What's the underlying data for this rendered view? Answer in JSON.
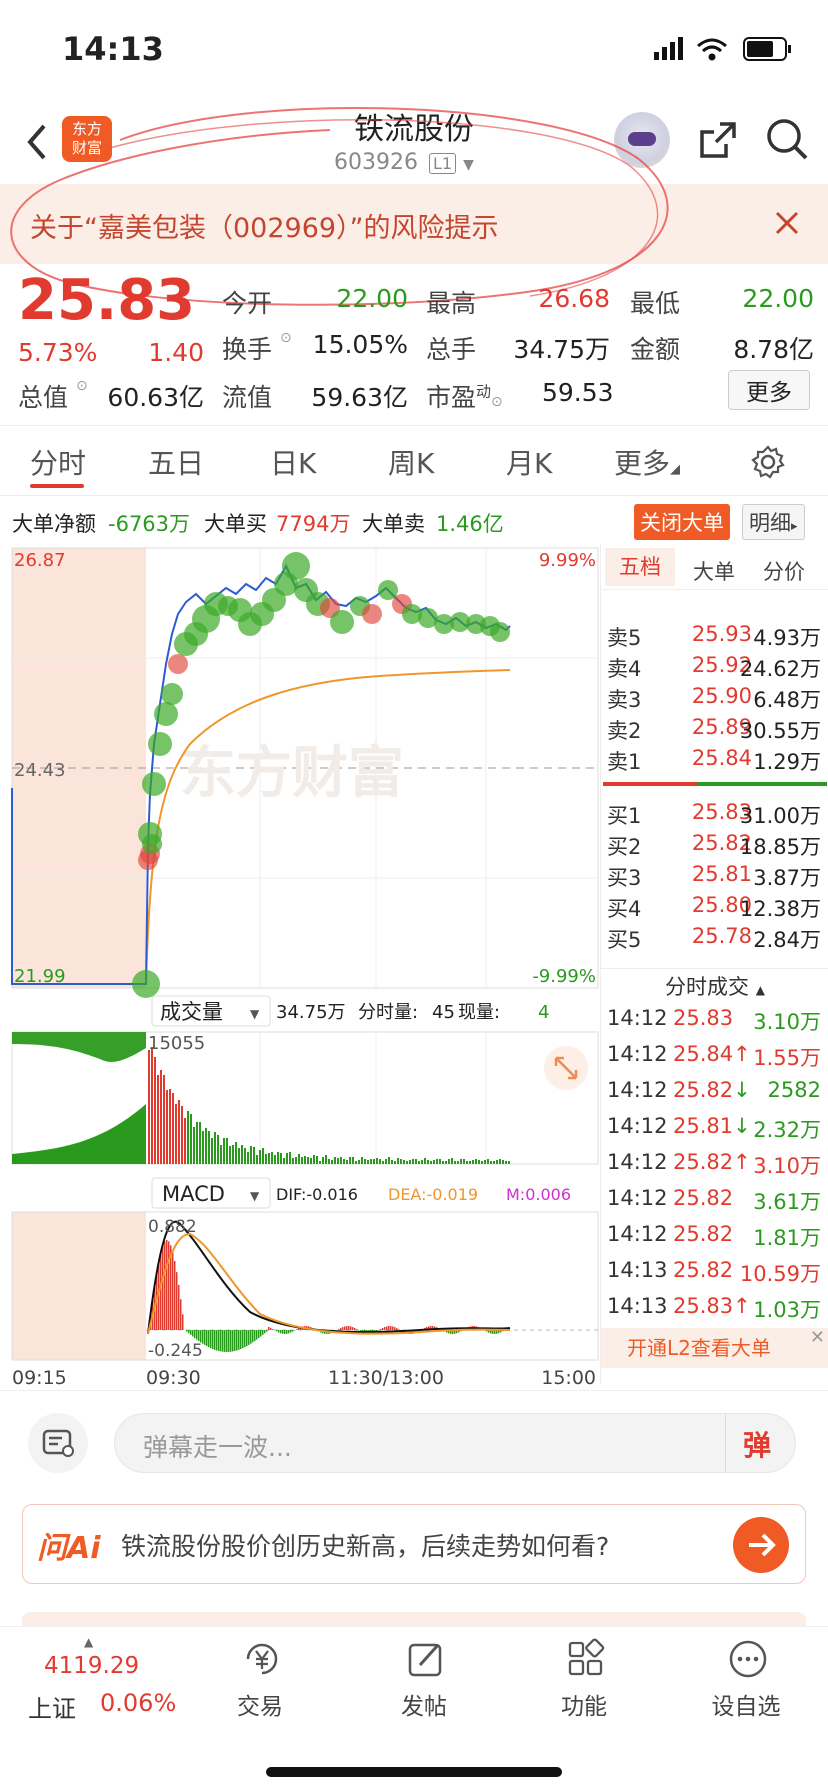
{
  "status": {
    "time": "14:13"
  },
  "header": {
    "logo_text": "东方财富",
    "stock_name": "铁流股份",
    "stock_code": "603926",
    "level": "L1"
  },
  "banner": {
    "text": "关于“嘉美包装（002969）”的风险提示"
  },
  "quote": {
    "price": "25.83",
    "change_pct": "5.73%",
    "change": "1.40",
    "open_label": "今开",
    "open": "22.00",
    "high_label": "最高",
    "high": "26.68",
    "low_label": "最低",
    "low": "22.00",
    "turnover_label": "换手",
    "turnover": "15.05%",
    "volume_label": "总手",
    "volume": "34.75万",
    "amount_label": "金额",
    "amount": "8.78亿",
    "mktcap_label": "总值",
    "mktcap": "60.63亿",
    "float_label": "流值",
    "float": "59.63亿",
    "pe_label": "市盈",
    "pe_sup": "动",
    "pe": "59.53",
    "more_button": "更多"
  },
  "tabs": [
    "分时",
    "五日",
    "日K",
    "周K",
    "月K",
    "更多"
  ],
  "big_orders": {
    "net_label": "大单净额",
    "net": "-6763万",
    "buy_label": "大单买",
    "buy": "7794万",
    "sell_label": "大单卖",
    "sell": "1.46亿",
    "close_button": "关闭大单",
    "detail_button": "明细"
  },
  "chart": {
    "price_high": "26.87",
    "price_mid": "24.43",
    "price_low": "21.99",
    "pct_high": "9.99%",
    "pct_low": "-9.99%",
    "watermark": "东方财富",
    "vol_selector": "成交量",
    "vol_total": "34.75万",
    "vol_time_label": "分时量:",
    "vol_time": "45",
    "vol_now_label": "现量:",
    "vol_now": "4",
    "vol_max": "15055",
    "macd_selector": "MACD",
    "dif": "DIF:-0.016",
    "dea": "DEA:-0.019",
    "m": "M:0.006",
    "macd_high": "0.882",
    "macd_low": "-0.245",
    "t1": "09:15",
    "t2": "09:30",
    "t3": "11:30/13:00",
    "t4": "15:00",
    "colors": {
      "price_line": "#2d5bd0",
      "avg_line": "#f0962a",
      "up": "#e13a2f",
      "down": "#2a9a1e",
      "pre_market_bg": "#fbe5da"
    }
  },
  "order_book": {
    "tabs": [
      "五档",
      "大单",
      "分价"
    ],
    "sells": [
      {
        "label": "卖5",
        "price": "25.93",
        "vol": "4.93万"
      },
      {
        "label": "卖4",
        "price": "25.92",
        "vol": "24.62万"
      },
      {
        "label": "卖3",
        "price": "25.90",
        "vol": "6.48万"
      },
      {
        "label": "卖2",
        "price": "25.89",
        "vol": "30.55万"
      },
      {
        "label": "卖1",
        "price": "25.84",
        "vol": "1.29万"
      }
    ],
    "buys": [
      {
        "label": "买1",
        "price": "25.83",
        "vol": "31.00万"
      },
      {
        "label": "买2",
        "price": "25.82",
        "vol": "18.85万"
      },
      {
        "label": "买3",
        "price": "25.81",
        "vol": "3.87万"
      },
      {
        "label": "买4",
        "price": "25.80",
        "vol": "12.38万"
      },
      {
        "label": "买5",
        "price": "25.78",
        "vol": "2.84万"
      }
    ],
    "ticks_title": "分时成交",
    "ticks": [
      {
        "time": "14:12",
        "price": "25.83",
        "arrow": "",
        "vol": "3.10万",
        "vcolor": "green"
      },
      {
        "time": "14:12",
        "price": "25.84",
        "arrow": "↑",
        "vol": "1.55万",
        "vcolor": "red"
      },
      {
        "time": "14:12",
        "price": "25.82",
        "arrow": "↓",
        "vol": "2582",
        "vcolor": "green"
      },
      {
        "time": "14:12",
        "price": "25.81",
        "arrow": "↓",
        "vol": "2.32万",
        "vcolor": "green"
      },
      {
        "time": "14:12",
        "price": "25.82",
        "arrow": "↑",
        "vol": "3.10万",
        "vcolor": "red"
      },
      {
        "time": "14:12",
        "price": "25.82",
        "arrow": "",
        "vol": "3.61万",
        "vcolor": "green"
      },
      {
        "time": "14:12",
        "price": "25.82",
        "arrow": "",
        "vol": "1.81万",
        "vcolor": "green"
      },
      {
        "time": "14:13",
        "price": "25.82",
        "arrow": "",
        "vol": "10.59万",
        "vcolor": "red"
      },
      {
        "time": "14:13",
        "price": "25.83",
        "arrow": "↑",
        "vol": "1.03万",
        "vcolor": "green"
      }
    ],
    "l2_promo": "开通L2查看大单"
  },
  "danmu": {
    "placeholder": "弹幕走一波...",
    "button": "弹"
  },
  "ai": {
    "logo": "问Ai",
    "question": "铁流股份股价创历史新高，后续走势如何看?"
  },
  "bottom_nav": {
    "index_value": "4119.29",
    "index_name": "上证",
    "index_pct": "0.06%",
    "items": [
      "交易",
      "发帖",
      "功能",
      "设自选"
    ]
  }
}
